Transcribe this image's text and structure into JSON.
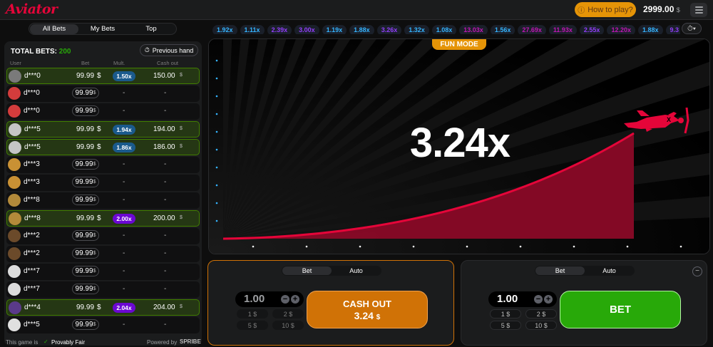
{
  "header": {
    "logo": "Aviator",
    "how_to_play": "How to play?",
    "balance": "2999.00",
    "currency": "$"
  },
  "bets_tabs": [
    "All Bets",
    "My Bets",
    "Top"
  ],
  "bets_panel": {
    "total_label": "TOTAL BETS:",
    "total_count": "200",
    "previous_hand": "Previous hand",
    "columns": {
      "user": "User",
      "bet": "Bet",
      "mult": "Mult.",
      "cashout": "Cash out"
    },
    "rows": [
      {
        "user": "d***0",
        "bet": "99.99",
        "mult": "1.50x",
        "cashout": "150.00",
        "win": true,
        "mult_color": "#1a5a8c",
        "avatar": "#7a7a7a"
      },
      {
        "user": "d***0",
        "bet": "99.99",
        "mult": "-",
        "cashout": "-",
        "win": false,
        "avatar": "#d33c3c"
      },
      {
        "user": "d***0",
        "bet": "99.99",
        "mult": "-",
        "cashout": "-",
        "win": false,
        "avatar": "#d33c3c"
      },
      {
        "user": "d***5",
        "bet": "99.99",
        "mult": "1.94x",
        "cashout": "194.00",
        "win": true,
        "mult_color": "#1a5a8c",
        "avatar": "#c5c5c5"
      },
      {
        "user": "d***5",
        "bet": "99.99",
        "mult": "1.86x",
        "cashout": "186.00",
        "win": true,
        "mult_color": "#1a5a8c",
        "avatar": "#c5c5c5"
      },
      {
        "user": "d***3",
        "bet": "99.99",
        "mult": "-",
        "cashout": "-",
        "win": false,
        "avatar": "#c99134"
      },
      {
        "user": "d***3",
        "bet": "99.99",
        "mult": "-",
        "cashout": "-",
        "win": false,
        "avatar": "#c99134"
      },
      {
        "user": "d***8",
        "bet": "99.99",
        "mult": "-",
        "cashout": "-",
        "win": false,
        "avatar": "#b38a3a"
      },
      {
        "user": "d***8",
        "bet": "99.99",
        "mult": "2.00x",
        "cashout": "200.00",
        "win": true,
        "mult_color": "#6b07d2",
        "avatar": "#b38a3a"
      },
      {
        "user": "d***2",
        "bet": "99.99",
        "mult": "-",
        "cashout": "-",
        "win": false,
        "avatar": "#6b4a2a"
      },
      {
        "user": "d***2",
        "bet": "99.99",
        "mult": "-",
        "cashout": "-",
        "win": false,
        "avatar": "#6b4a2a"
      },
      {
        "user": "d***7",
        "bet": "99.99",
        "mult": "-",
        "cashout": "-",
        "win": false,
        "avatar": "#dcdcdc"
      },
      {
        "user": "d***7",
        "bet": "99.99",
        "mult": "-",
        "cashout": "-",
        "win": false,
        "avatar": "#dcdcdc"
      },
      {
        "user": "d***4",
        "bet": "99.99",
        "mult": "2.04x",
        "cashout": "204.00",
        "win": true,
        "mult_color": "#6b07d2",
        "avatar": "#5a3a8a"
      },
      {
        "user": "d***5",
        "bet": "99.99",
        "mult": "-",
        "cashout": "-",
        "win": false,
        "avatar": "#e0e0e0"
      }
    ],
    "footer_left": "This game is",
    "provably_fair": "Provably Fair",
    "footer_right": "Powered by",
    "brand": "SPRIBE"
  },
  "history": [
    {
      "v": "1.92x",
      "c": "#34b4ff"
    },
    {
      "v": "1.11x",
      "c": "#34b4ff"
    },
    {
      "v": "2.39x",
      "c": "#913ef8"
    },
    {
      "v": "3.00x",
      "c": "#913ef8"
    },
    {
      "v": "1.19x",
      "c": "#34b4ff"
    },
    {
      "v": "1.88x",
      "c": "#34b4ff"
    },
    {
      "v": "3.26x",
      "c": "#913ef8"
    },
    {
      "v": "1.32x",
      "c": "#34b4ff"
    },
    {
      "v": "1.08x",
      "c": "#34b4ff"
    },
    {
      "v": "13.03x",
      "c": "#c017b4"
    },
    {
      "v": "1.56x",
      "c": "#34b4ff"
    },
    {
      "v": "27.69x",
      "c": "#c017b4"
    },
    {
      "v": "11.93x",
      "c": "#c017b4"
    },
    {
      "v": "2.55x",
      "c": "#913ef8"
    },
    {
      "v": "12.20x",
      "c": "#c017b4"
    },
    {
      "v": "1.88x",
      "c": "#34b4ff"
    },
    {
      "v": "9.3",
      "c": "#913ef8"
    }
  ],
  "stage": {
    "fun_mode": "FUN MODE",
    "multiplier": "3.24x",
    "accent": "#e50539"
  },
  "bet_panels": [
    {
      "tabs": [
        "Bet",
        "Auto"
      ],
      "amount": "1.00",
      "quick": [
        "1",
        "2",
        "5",
        "10"
      ],
      "currency": "$",
      "action": "CASH OUT",
      "action_amount": "3.24",
      "state": "cashout"
    },
    {
      "tabs": [
        "Bet",
        "Auto"
      ],
      "amount": "1.00",
      "quick": [
        "1",
        "2",
        "5",
        "10"
      ],
      "currency": "$",
      "action": "BET",
      "state": "bet"
    }
  ]
}
